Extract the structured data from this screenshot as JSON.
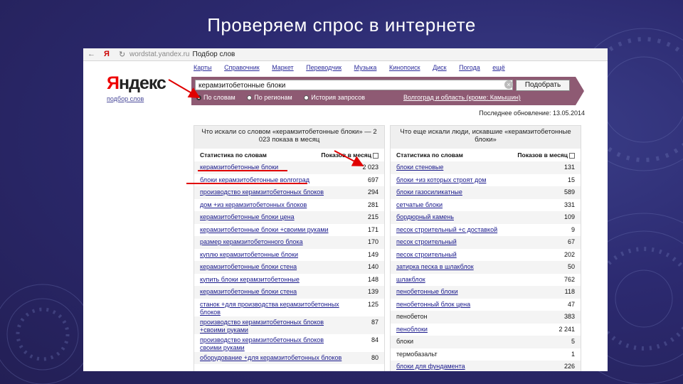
{
  "slide": {
    "title": "Проверяем спрос в интернете"
  },
  "browser": {
    "back_icon": "back-arrow-icon",
    "refresh_icon": "refresh-icon",
    "yandex_letter": "Я",
    "url": "wordstat.yandex.ru",
    "page_title": "Подбор слов"
  },
  "logo": {
    "ya": "Я",
    "rest": "ндекс",
    "subtitle": "подбор слов"
  },
  "top_links": [
    "Карты",
    "Справочник",
    "Маркет",
    "Переводчик",
    "Музыка",
    "Кинопоиск",
    "Диск",
    "Погода",
    "ещё"
  ],
  "search": {
    "value": "керамзитобетонные блоки",
    "button": "Подобрать",
    "radios": [
      {
        "label": "По словам",
        "selected": true
      },
      {
        "label": "По регионам",
        "selected": false
      },
      {
        "label": "История запросов",
        "selected": false
      }
    ],
    "region": "Волгоград и область (кроме: Камышин)"
  },
  "updated": "Последнее обновление: 13.05.2014",
  "left_panel": {
    "heading": "Что искали со словом «керамзитобетонные блоки» — 2 023 показа в месяц",
    "col_word": "Статистика по словам",
    "col_count": "Показов в месяц",
    "rows": [
      {
        "kw": "керамзитобетонные блоки",
        "ct": "2 023"
      },
      {
        "kw": "блоки керамзитобетонные волгоград",
        "ct": "697"
      },
      {
        "kw": "производство керамзитобетонных блоков",
        "ct": "294"
      },
      {
        "kw": "дом +из керамзитобетонных блоков",
        "ct": "281"
      },
      {
        "kw": "керамзитобетонные блоки цена",
        "ct": "215"
      },
      {
        "kw": "керамзитобетонные блоки +своими руками",
        "ct": "171"
      },
      {
        "kw": "размер керамзитобетонного блока",
        "ct": "170"
      },
      {
        "kw": "куплю керамзитобетонные блоки",
        "ct": "149"
      },
      {
        "kw": "керамзитобетонные блоки стена",
        "ct": "140"
      },
      {
        "kw": "купить блоки керамзитобетонные",
        "ct": "148"
      },
      {
        "kw": "керамзитобетонные блоки стена",
        "ct": "139"
      },
      {
        "kw": "станок +для производства керамзитобетонных блоков",
        "ct": "125"
      },
      {
        "kw": "производство керамзитобетонных блоков +своими руками",
        "ct": "87"
      },
      {
        "kw": "производство керамзитобетонных блоков своими руками",
        "ct": "84"
      },
      {
        "kw": "оборудование +для керамзитобетонных блоков",
        "ct": "80"
      }
    ]
  },
  "right_panel": {
    "heading": "Что еще искали люди, искавшие «керамзитобетонные блоки»",
    "col_word": "Статистика по словам",
    "col_count": "Показов в месяц",
    "rows": [
      {
        "kw": "блоки стеновые",
        "ct": "131"
      },
      {
        "kw": "блоки +из которых строят дом",
        "ct": "15"
      },
      {
        "kw": "блоки газосиликатные",
        "ct": "589"
      },
      {
        "kw": "сетчатые блоки",
        "ct": "331"
      },
      {
        "kw": "бордюрный камень",
        "ct": "109"
      },
      {
        "kw": "песок строительный +с доставкой",
        "ct": "9"
      },
      {
        "kw": "песок строительный",
        "ct": "67"
      },
      {
        "kw": "песок строительный",
        "ct": "202"
      },
      {
        "kw": "затирка песка в шлакблок",
        "ct": "50"
      },
      {
        "kw": "шлакблок",
        "ct": "762"
      },
      {
        "kw": "пенобетонные блоки",
        "ct": "118"
      },
      {
        "kw": "пенобетонный блок цена",
        "ct": "47"
      },
      {
        "kw": "пенобетон",
        "ct": "383",
        "plain": true
      },
      {
        "kw": "пеноблоки",
        "ct": "2 241"
      },
      {
        "kw": "блоки",
        "ct": "5",
        "plain": true
      },
      {
        "kw": "термобазальт",
        "ct": "1",
        "plain": true
      },
      {
        "kw": "блоки для фундамента",
        "ct": "226"
      }
    ]
  },
  "colors": {
    "slide_bg": "#2c2a70",
    "searchbar": "#8e5a73",
    "link": "#1a1a8c",
    "annotation": "#e00000"
  }
}
